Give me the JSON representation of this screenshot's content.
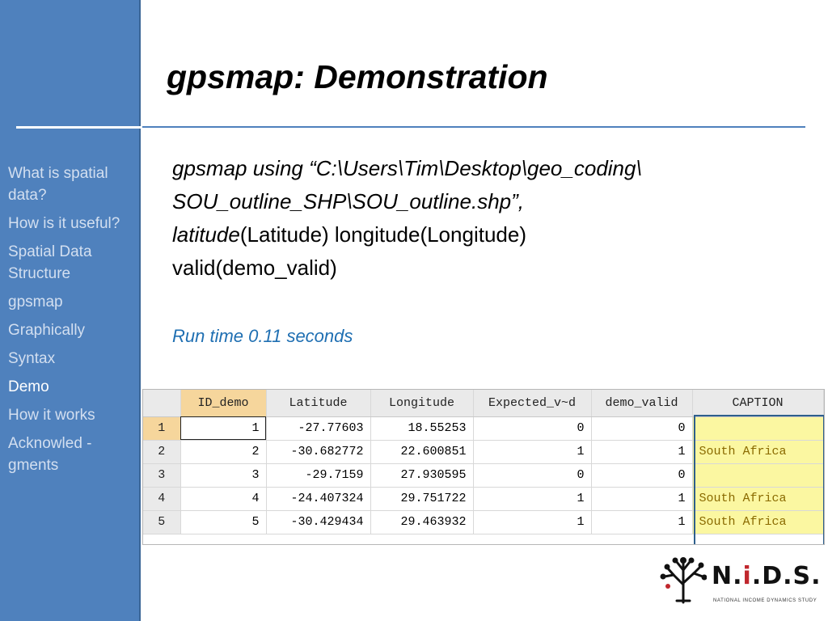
{
  "slide": {
    "title": "gpsmap: Demonstration",
    "command": {
      "part1": "gpsmap using  “C:\\Users\\Tim\\Desktop\\geo_coding\\",
      "part2": "SOU_outline_SHP\\SOU_outline.shp”,",
      "lat_keyword": "latitude",
      "lat_rest": "(Latitude) longitude(Longitude)",
      "line4": "valid(demo_valid)"
    },
    "runtime": "Run time 0.11 seconds"
  },
  "sidebar": {
    "items": [
      {
        "label": "What is spatial data?"
      },
      {
        "label": "How is it useful?"
      },
      {
        "label": "Spatial Data Structure"
      },
      {
        "label": "gpsmap"
      },
      {
        "label": "Graphically"
      },
      {
        "label": "Syntax"
      },
      {
        "label": "Demo",
        "active": true
      },
      {
        "label": "How it works"
      },
      {
        "label": "Acknowled - gments"
      }
    ]
  },
  "data_grid": {
    "columns": [
      "ID_demo",
      "Latitude",
      "Longitude",
      "Expected_v~d",
      "demo_valid",
      "CAPTION"
    ],
    "rows": [
      {
        "num": "1",
        "ID_demo": "1",
        "Latitude": "-27.77603",
        "Longitude": "18.55253",
        "Expected": "0",
        "demo_valid": "0",
        "CAPTION": ""
      },
      {
        "num": "2",
        "ID_demo": "2",
        "Latitude": "-30.682772",
        "Longitude": "22.600851",
        "Expected": "1",
        "demo_valid": "1",
        "CAPTION": "South Africa"
      },
      {
        "num": "3",
        "ID_demo": "3",
        "Latitude": "-29.7159",
        "Longitude": "27.930595",
        "Expected": "0",
        "demo_valid": "0",
        "CAPTION": ""
      },
      {
        "num": "4",
        "ID_demo": "4",
        "Latitude": "-24.407324",
        "Longitude": "29.751722",
        "Expected": "1",
        "demo_valid": "1",
        "CAPTION": "South Africa"
      },
      {
        "num": "5",
        "ID_demo": "5",
        "Latitude": "-30.429434",
        "Longitude": "29.463932",
        "Expected": "1",
        "demo_valid": "1",
        "CAPTION": "South Africa"
      }
    ]
  },
  "logo": {
    "text_a": "N.",
    "text_i": "i",
    "text_b": ".D.S.",
    "subtitle": "NATIONAL INCOME DYNAMICS STUDY",
    "colors": {
      "accent": "#c0272d",
      "dark": "#111111"
    }
  },
  "colors": {
    "sidebar": "#4f81bd",
    "runtime": "#1f6fb2",
    "caption_bg": "#fbf7a1",
    "header_highlight": "#f6d69c"
  }
}
